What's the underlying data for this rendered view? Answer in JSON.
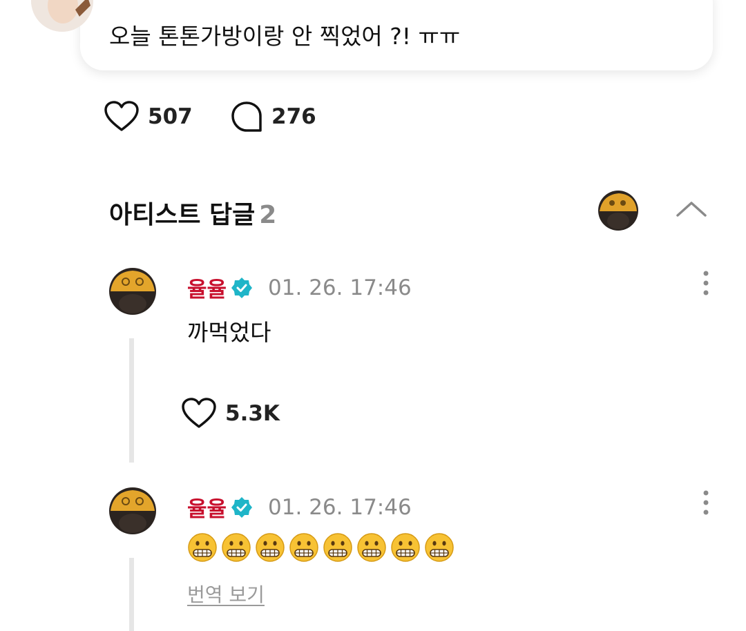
{
  "post": {
    "text": "오늘 톤톤가방이랑 안 찍었어 ?! ㅠㅠ",
    "likes": "507",
    "comments": "276"
  },
  "artist_replies": {
    "title": "아티스트 답글",
    "count": "2",
    "replies": [
      {
        "author": "율율",
        "time": "01. 26. 17:46",
        "text": "까먹었다",
        "likes": "5.3K"
      },
      {
        "author": "율율",
        "time": "01. 26. 17:46",
        "text": "😬😬😬😬😬😬😬😬",
        "translate_label": "번역 보기"
      }
    ]
  },
  "colors": {
    "artist_name": "#c8102e",
    "verified_badge": "#1fb5c8",
    "muted_text": "#8a8a8a"
  }
}
